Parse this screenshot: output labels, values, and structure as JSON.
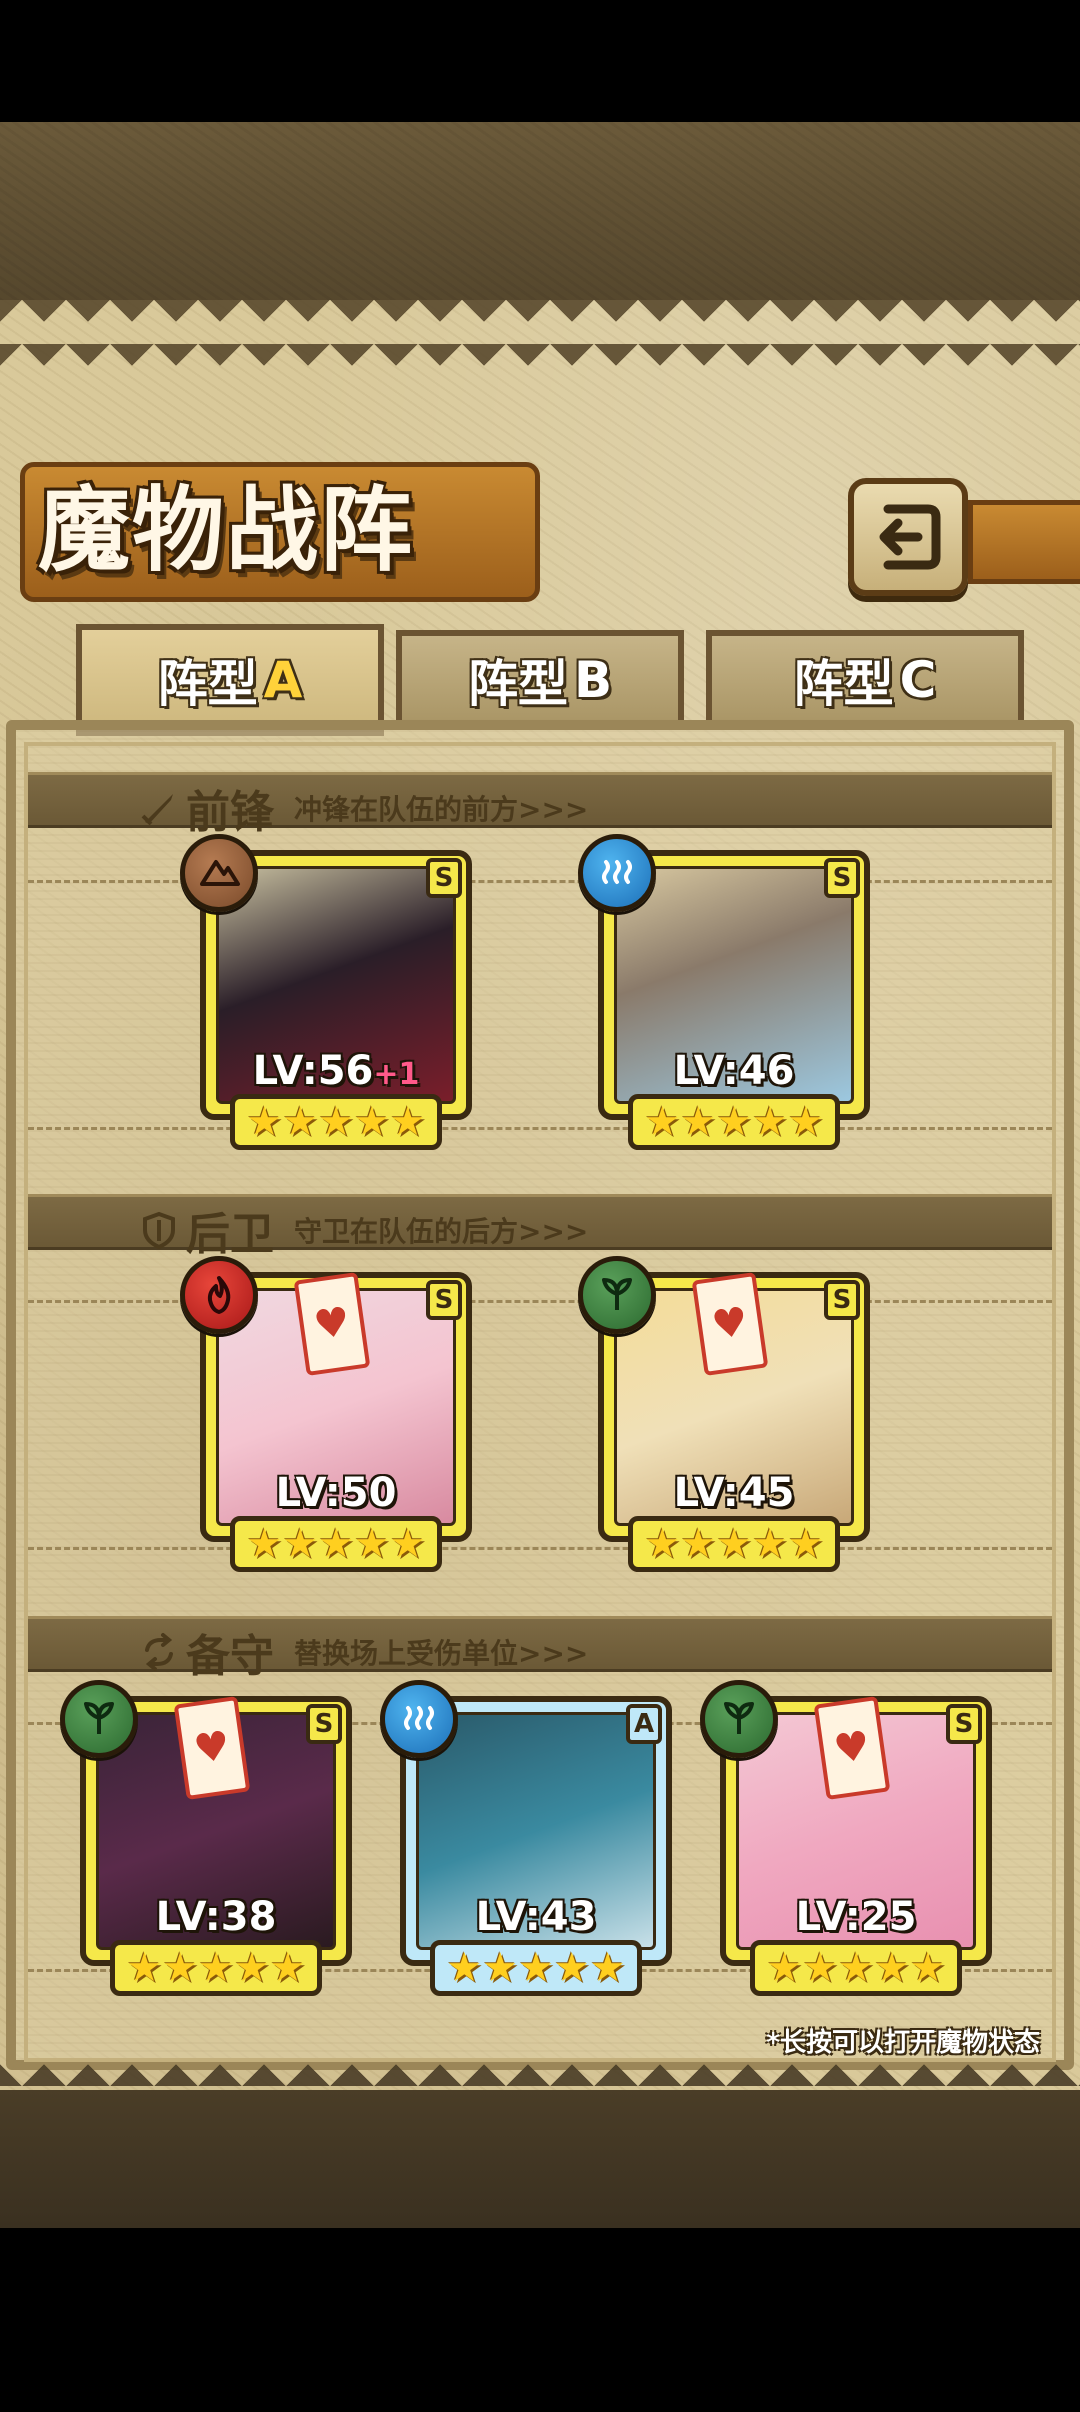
{
  "screen": {
    "title": "魔物战阵",
    "footnote": "*长按可以打开魔物状态"
  },
  "tabs": [
    {
      "label": "阵型",
      "letter": "A",
      "active": true
    },
    {
      "label": "阵型",
      "letter": "B",
      "active": false
    },
    {
      "label": "阵型",
      "letter": "C",
      "active": false
    }
  ],
  "sections": {
    "vanguard": {
      "name": "前锋",
      "desc": "冲锋在队伍的前方>>>",
      "icon": "sword-icon"
    },
    "rearguard": {
      "name": "后卫",
      "desc": "守卫在队伍的后方>>>",
      "icon": "shield-icon"
    },
    "reserve": {
      "name": "备守",
      "desc": "替换场上受伤单位>>>",
      "icon": "swap-icon"
    }
  },
  "units": {
    "vanguard": [
      {
        "level": "LV:56",
        "bonus": "+1",
        "rank": "S",
        "element": "earth",
        "stars": 5,
        "sealed": false
      },
      {
        "level": "LV:46",
        "bonus": "",
        "rank": "S",
        "element": "water",
        "stars": 5,
        "sealed": false
      }
    ],
    "rearguard": [
      {
        "level": "LV:50",
        "bonus": "",
        "rank": "S",
        "element": "fire",
        "stars": 5,
        "sealed": true
      },
      {
        "level": "LV:45",
        "bonus": "",
        "rank": "S",
        "element": "nature",
        "stars": 5,
        "sealed": true
      }
    ],
    "reserve": [
      {
        "level": "LV:38",
        "bonus": "",
        "rank": "S",
        "element": "nature",
        "stars": 5,
        "sealed": true
      },
      {
        "level": "LV:43",
        "bonus": "",
        "rank": "A",
        "element": "water",
        "stars": 5,
        "sealed": false
      },
      {
        "level": "LV:25",
        "bonus": "",
        "rank": "S",
        "element": "nature",
        "stars": 5,
        "sealed": true
      }
    ]
  },
  "colors": {
    "frame_gold": "#f5e84a",
    "frame_blue": "#bfe8f8",
    "parchment": "#d9c99a",
    "title_plate": "#c98a32"
  }
}
